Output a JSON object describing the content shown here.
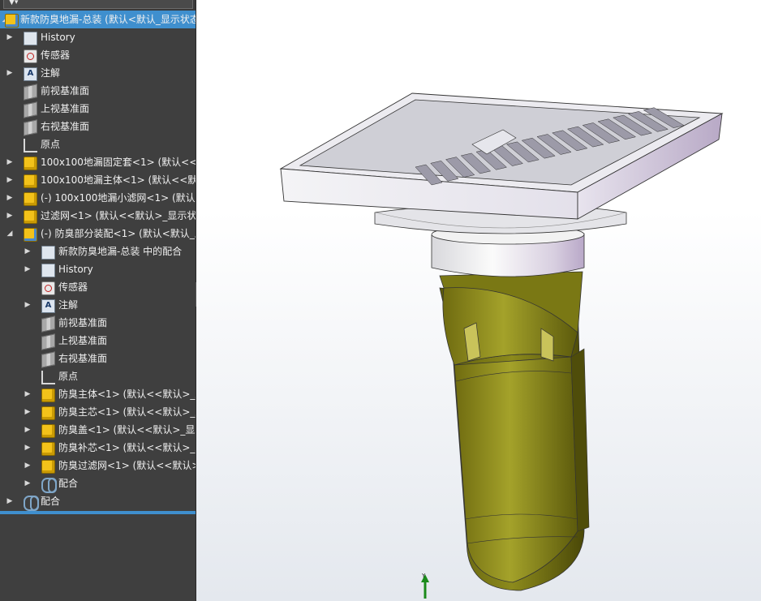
{
  "tree": {
    "rows": [
      {
        "label": "新款防臭地漏-总装 (默认<默认_显示状态",
        "icon": "assembly-root-icon",
        "arrow": "down",
        "level": 0,
        "selected": true
      },
      {
        "label": "History",
        "icon": "history-folder-icon",
        "arrow": "right",
        "level": 1
      },
      {
        "label": "传感器",
        "icon": "sensor-icon",
        "arrow": "",
        "level": 1
      },
      {
        "label": "注解",
        "icon": "annotation-icon",
        "arrow": "right",
        "level": 1
      },
      {
        "label": "前视基准面",
        "icon": "plane-icon",
        "arrow": "",
        "level": 1
      },
      {
        "label": "上视基准面",
        "icon": "plane-icon",
        "arrow": "",
        "level": 1
      },
      {
        "label": "右视基准面",
        "icon": "plane-icon",
        "arrow": "",
        "level": 1
      },
      {
        "label": "原点",
        "icon": "origin-icon",
        "arrow": "",
        "level": 1
      },
      {
        "label": "100x100地漏固定套<1> (默认<<默",
        "icon": "part-icon",
        "arrow": "right",
        "level": 1
      },
      {
        "label": "100x100地漏主体<1> (默认<<默认",
        "icon": "part-icon",
        "arrow": "right",
        "level": 1
      },
      {
        "label": "(-) 100x100地漏小滤网<1> (默认<",
        "icon": "part-icon",
        "arrow": "right",
        "level": 1
      },
      {
        "label": "过滤网<1> (默认<<默认>_显示状态",
        "icon": "part-icon",
        "arrow": "right",
        "level": 1
      },
      {
        "label": "(-) 防臭部分装配<1> (默认<默认_显",
        "icon": "subassembly-icon",
        "arrow": "down",
        "level": 1
      },
      {
        "label": "新款防臭地漏-总装 中的配合",
        "icon": "mates-folder-icon",
        "arrow": "right",
        "level": 2
      },
      {
        "label": "History",
        "icon": "history-folder-icon",
        "arrow": "right",
        "level": 2
      },
      {
        "label": "传感器",
        "icon": "sensor-icon",
        "arrow": "",
        "level": 2
      },
      {
        "label": "注解",
        "icon": "annotation-icon",
        "arrow": "right",
        "level": 2
      },
      {
        "label": "前视基准面",
        "icon": "plane-icon",
        "arrow": "",
        "level": 2
      },
      {
        "label": "上视基准面",
        "icon": "plane-icon",
        "arrow": "",
        "level": 2
      },
      {
        "label": "右视基准面",
        "icon": "plane-icon",
        "arrow": "",
        "level": 2
      },
      {
        "label": "原点",
        "icon": "origin-icon",
        "arrow": "",
        "level": 2
      },
      {
        "label": "防臭主体<1> (默认<<默认>_显",
        "icon": "part-icon",
        "arrow": "right",
        "level": 2
      },
      {
        "label": "防臭主芯<1> (默认<<默认>_显",
        "icon": "part-icon",
        "arrow": "right",
        "level": 2
      },
      {
        "label": "防臭盖<1> (默认<<默认>_显示",
        "icon": "part-icon",
        "arrow": "right",
        "level": 2
      },
      {
        "label": "防臭补芯<1> (默认<<默认>_显",
        "icon": "part-icon",
        "arrow": "right",
        "level": 2
      },
      {
        "label": "防臭过滤网<1> (默认<<默认>",
        "icon": "part-icon",
        "arrow": "right",
        "level": 2
      },
      {
        "label": "配合",
        "icon": "mates-icon",
        "arrow": "right",
        "level": 2
      },
      {
        "label": "配合",
        "icon": "mates-icon",
        "arrow": "right",
        "level": 1
      }
    ]
  },
  "viewport": {
    "triad_axis": "Y"
  },
  "colors": {
    "panel_bg": "#3f3f3f",
    "selection": "#3f8fce",
    "grate_silver": "#d9d9de",
    "body_olive": "#8c8a1c",
    "collar_white": "#eeeeef"
  }
}
